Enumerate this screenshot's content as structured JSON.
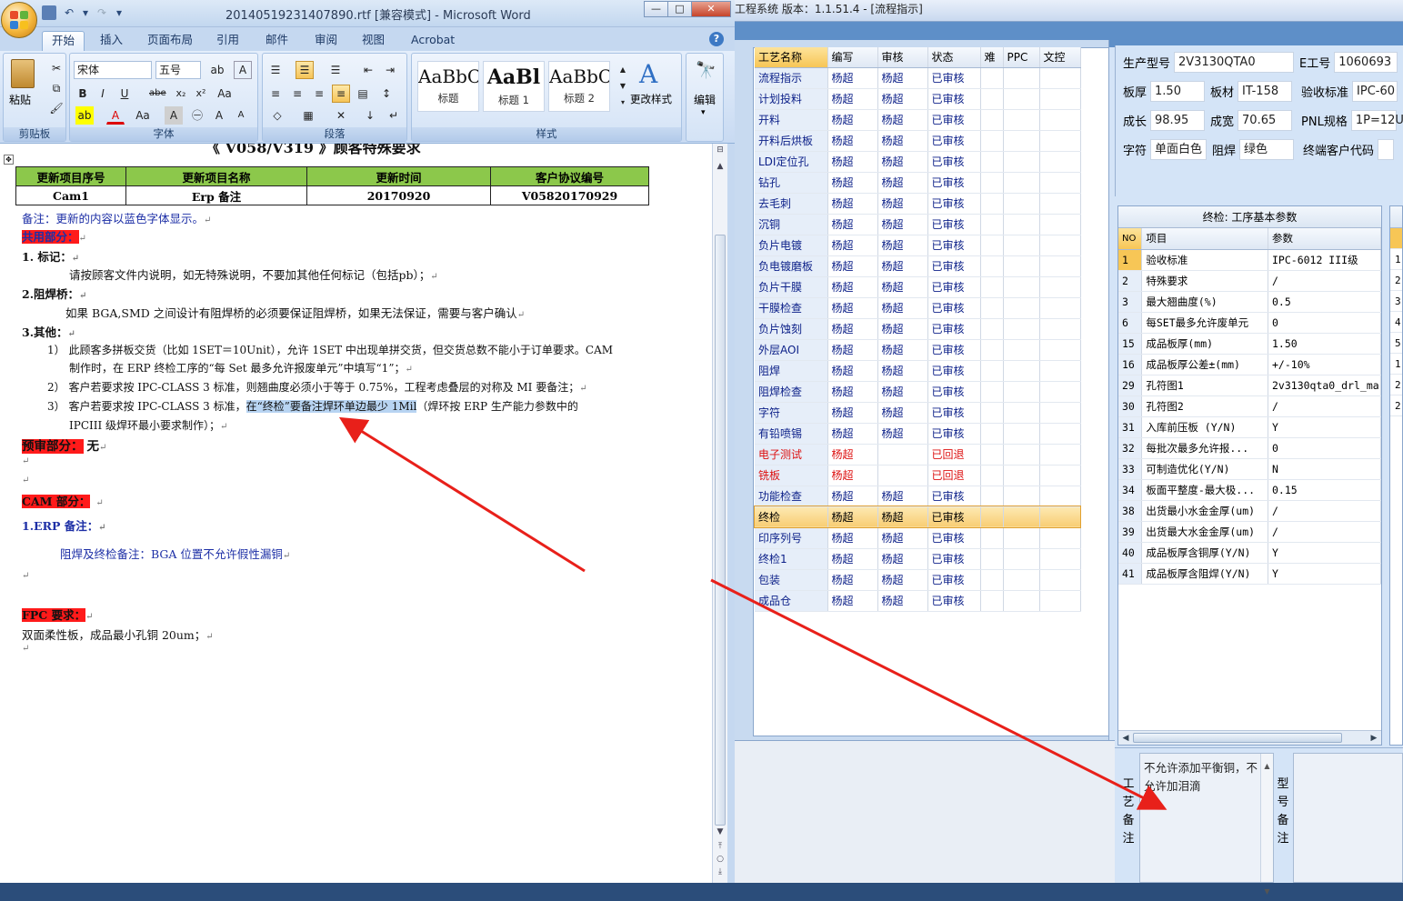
{
  "word": {
    "title": "20140519231407890.rtf [兼容模式] - Microsoft Word",
    "tabs": [
      "开始",
      "插入",
      "页面布局",
      "引用",
      "邮件",
      "审阅",
      "视图",
      "Acrobat"
    ],
    "ribbon": {
      "clipboard_group": "剪贴板",
      "paste_label": "粘贴",
      "font_group": "字体",
      "font_name": "宋体",
      "font_size": "五号",
      "paragraph_group": "段落",
      "styles_group": "样式",
      "styles": [
        {
          "sample": "AaBbC",
          "name": "标题"
        },
        {
          "sample": "AaBl",
          "name": "标题 1"
        },
        {
          "sample": "AaBbC",
          "name": "标题 2"
        }
      ],
      "change_styles": "更改样式",
      "edit": "编辑"
    },
    "doc": {
      "cut_title": "《 V058/V319 》顾客特殊要求",
      "table_headers": [
        "更新项目序号",
        "更新项目名称",
        "更新时间",
        "客户协议编号"
      ],
      "table_row": [
        "Cam1",
        "Erp 备注",
        "20170920",
        "V05820170929"
      ],
      "note": "备注：更新的内容以蓝色字体显示。",
      "common_section": "共用部分：",
      "s1_title": "1.   标记：",
      "s1_body": "请按顾客文件内说明，如无特殊说明，不要加其他任何标记（包括pb）；",
      "s2_title": "2.阻焊桥：",
      "s2_body": "如果 BGA,SMD 之间设计有阻焊桥的必须要保证阻焊桥，如果无法保证，需要与客户确认",
      "s3_title": "3.其他：",
      "s3_i1a": "1） 此顾客多拼板交货（比如 1SET＝10Unit），允许 1SET 中出现单拼交货，但交货总数不能小于订单要求。CAM",
      "s3_i1b": "制作时，在 ERP 终检工序的“每 Set 最多允许报废单元”中填写“1”；",
      "s3_i2": "2） 客户若要求按 IPC-CLASS 3 标准，则翘曲度必须小于等于 0.75%，工程考虑叠层的对称及 MI 要备注；",
      "s3_i3_pre": "3） 客户若要求按 IPC-CLASS 3 标准，",
      "s3_i3_hl": "在“终检”要备注焊环单边最少 1Mil",
      "s3_i3_post": "（焊环按 ERP 生产能力参数中的",
      "s3_i3_b": "IPCIII 级焊环最小要求制作）；",
      "preaudit": "预审部分：",
      "preaudit_val": "无",
      "cam_section": "CAM 部分：",
      "erp_note_title": "1.ERP 备注：",
      "erp_note_body": "阻焊及终检备注：BGA 位置不允许假性漏铜",
      "fpc_section": "FPC 要求：",
      "fpc_body": "双面柔性板，成品最小孔铜 20um；"
    }
  },
  "erp": {
    "title": "工程系统   版本：1.1.51.4 - [流程指示]",
    "route_headers": [
      "工艺名称",
      "编写",
      "审核",
      "状态",
      "难",
      "PPC",
      "文控"
    ],
    "route_rows": [
      [
        "流程指示",
        "杨超",
        "杨超",
        "已审核",
        "normal"
      ],
      [
        "计划投料",
        "杨超",
        "杨超",
        "已审核",
        "normal"
      ],
      [
        "开料",
        "杨超",
        "杨超",
        "已审核",
        "normal"
      ],
      [
        "开料后烘板",
        "杨超",
        "杨超",
        "已审核",
        "normal"
      ],
      [
        "LDI定位孔",
        "杨超",
        "杨超",
        "已审核",
        "normal"
      ],
      [
        "钻孔",
        "杨超",
        "杨超",
        "已审核",
        "normal"
      ],
      [
        "去毛刺",
        "杨超",
        "杨超",
        "已审核",
        "normal"
      ],
      [
        "沉铜",
        "杨超",
        "杨超",
        "已审核",
        "normal"
      ],
      [
        "负片电镀",
        "杨超",
        "杨超",
        "已审核",
        "normal"
      ],
      [
        "负电镀磨板",
        "杨超",
        "杨超",
        "已审核",
        "normal"
      ],
      [
        "负片干膜",
        "杨超",
        "杨超",
        "已审核",
        "normal"
      ],
      [
        "干膜检查",
        "杨超",
        "杨超",
        "已审核",
        "normal"
      ],
      [
        "负片蚀刻",
        "杨超",
        "杨超",
        "已审核",
        "normal"
      ],
      [
        "外层AOI",
        "杨超",
        "杨超",
        "已审核",
        "normal"
      ],
      [
        "阻焊",
        "杨超",
        "杨超",
        "已审核",
        "normal"
      ],
      [
        "阻焊检查",
        "杨超",
        "杨超",
        "已审核",
        "normal"
      ],
      [
        "字符",
        "杨超",
        "杨超",
        "已审核",
        "normal"
      ],
      [
        "有铅喷锡",
        "杨超",
        "杨超",
        "已审核",
        "normal"
      ],
      [
        "电子测试",
        "杨超",
        "",
        "已回退",
        "rev"
      ],
      [
        "铣板",
        "杨超",
        "",
        "已回退",
        "rev"
      ],
      [
        "功能检查",
        "杨超",
        "杨超",
        "已审核",
        "normal"
      ],
      [
        "终检",
        "杨超",
        "杨超",
        "已审核",
        "sel"
      ],
      [
        "印序列号",
        "杨超",
        "杨超",
        "已审核",
        "normal"
      ],
      [
        "终检1",
        "杨超",
        "杨超",
        "已审核",
        "normal"
      ],
      [
        "包装",
        "杨超",
        "杨超",
        "已审核",
        "normal"
      ],
      [
        "成品仓",
        "杨超",
        "杨超",
        "已审核",
        "normal"
      ]
    ],
    "info": {
      "model_label": "生产型号",
      "model": "2V3130QTA0",
      "eno_label": "E工号",
      "eno": "1060693",
      "thick_label": "板厚",
      "thick": "1.50",
      "mat_label": "板材",
      "mat": "IT-158",
      "std_label": "验收标准",
      "std": "IPC-60",
      "len_label": "成长",
      "len": "98.95",
      "wid_label": "成宽",
      "wid": "70.65",
      "pnl_label": "PNL规格",
      "pnl": "1P=12U",
      "char_label": "字符",
      "char": "单面白色",
      "mask_label": "阻焊",
      "mask": "绿色",
      "cust_label": "终端客户代码",
      "cust": ""
    },
    "inspection": {
      "title": "终检: 工序基本参数",
      "headers": [
        "NO",
        "项目",
        "参数"
      ],
      "rows": [
        [
          "1",
          "验收标准",
          "IPC-6012 III级"
        ],
        [
          "2",
          "特殊要求",
          "/"
        ],
        [
          "3",
          "最大翘曲度(%)",
          "0.5"
        ],
        [
          "6",
          "每SET最多允许废单元",
          "0"
        ],
        [
          "15",
          "成品板厚(mm)",
          "1.50"
        ],
        [
          "16",
          "成品板厚公差±(mm)",
          "+/-10%"
        ],
        [
          "29",
          "孔符图1",
          "2v3130qta0_drl_ma"
        ],
        [
          "30",
          "孔符图2",
          "/"
        ],
        [
          "31",
          "入库前压板 (Y/N)",
          "Y"
        ],
        [
          "32",
          "每批次最多允许报...",
          "0"
        ],
        [
          "33",
          "可制造优化(Y/N)",
          "N"
        ],
        [
          "34",
          "板面平整度-最大极...",
          "0.15"
        ],
        [
          "38",
          "出货最小水金金厚(um)",
          "/"
        ],
        [
          "39",
          "出货最大水金金厚(um)",
          "/"
        ],
        [
          "40",
          "成品板厚含铜厚(Y/N)",
          "Y"
        ],
        [
          "41",
          "成品板厚含阻焊(Y/N)",
          "Y"
        ]
      ],
      "second_panel_values": [
        "1",
        "2",
        "3",
        "4",
        "5",
        "1",
        "2",
        "2"
      ]
    },
    "process_remark_label": "工艺备注",
    "process_remark_text": "不允许添加平衡铜，不允许加泪滴",
    "model_remark_label": "型号备注"
  },
  "colors": {
    "highlight": "#f7c656",
    "arrow": "#e8201a",
    "section_red": "#ff1a1a",
    "link_blue": "#1d2fa6"
  }
}
